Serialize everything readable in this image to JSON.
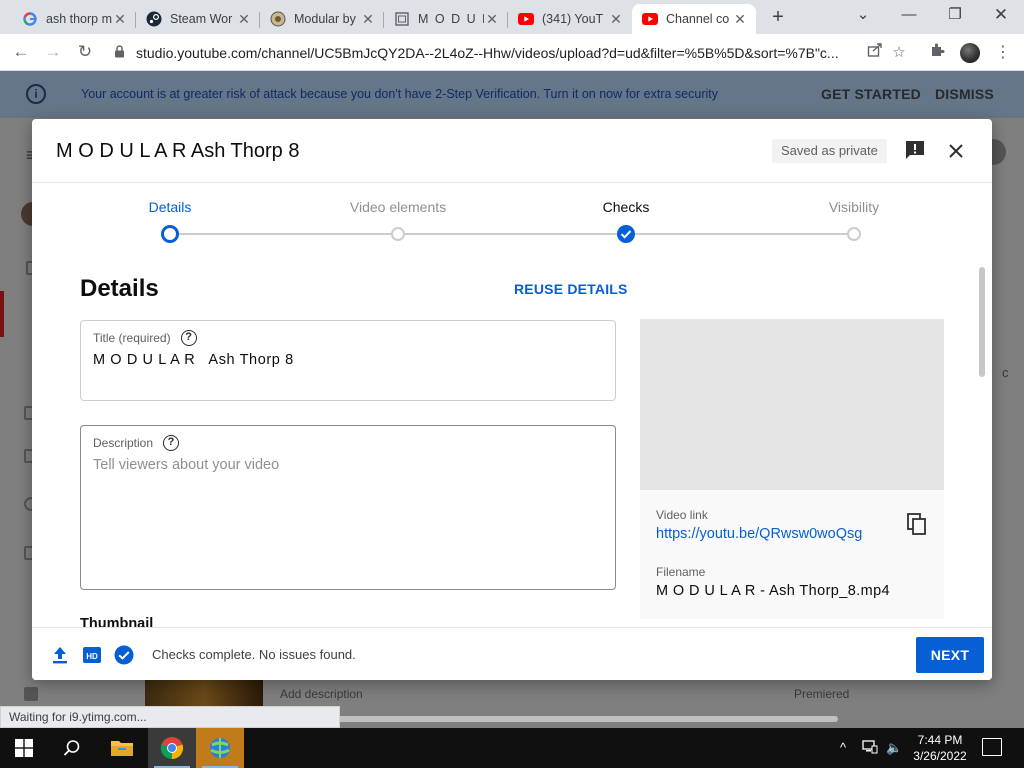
{
  "browser": {
    "tabs": [
      {
        "label": "ash thorp m",
        "icon": "google-icon"
      },
      {
        "label": "Steam Wor",
        "icon": "steam-icon"
      },
      {
        "label": "Modular by",
        "icon": "artstation-icon"
      },
      {
        "label": "M O D U L",
        "icon": "page-icon"
      },
      {
        "label": "(341) YouT",
        "icon": "youtube-icon"
      },
      {
        "label": "Channel co",
        "icon": "youtube-icon",
        "active": true
      }
    ],
    "url": "studio.youtube.com/channel/UC5BmJcQY2DA--2L4oZ--Hhw/videos/upload?d=ud&filter=%5B%5D&sort=%7B\"c...",
    "status_text": "Waiting for i9.ytimg.com..."
  },
  "warning_banner": {
    "message": "Your account is at greater risk of attack because you don't have 2-Step Verification. Turn it on now for extra security",
    "get_started": "GET STARTED",
    "dismiss": "DISMISS"
  },
  "background_page": {
    "row_description": "Add description",
    "row_status": "Premiered",
    "side_letter": "c"
  },
  "modal": {
    "title": "M O D U L A R Ash Thorp 8",
    "saved_badge": "Saved as private",
    "steps": [
      {
        "label": "Details",
        "state": "current"
      },
      {
        "label": "Video elements",
        "state": "todo"
      },
      {
        "label": "Checks",
        "state": "done"
      },
      {
        "label": "Visibility",
        "state": "todo"
      }
    ],
    "section_title": "Details",
    "reuse_details": "REUSE DETAILS",
    "title_field": {
      "label": "Title (required)",
      "value": "M O D U L A R   Ash Thorp 8"
    },
    "description_field": {
      "label": "Description",
      "placeholder": "Tell viewers about your video"
    },
    "thumbnail_heading": "Thumbnail",
    "video_link_label": "Video link",
    "video_link": "https://youtu.be/QRwsw0woQsg",
    "filename_label": "Filename",
    "filename": "M O D U L A R - Ash Thorp_8.mp4",
    "footer_status": "Checks complete. No issues found.",
    "next_button": "NEXT"
  },
  "taskbar": {
    "time": "7:44 PM",
    "date": "3/26/2022"
  },
  "colors": {
    "accent": "#065fd4",
    "banner_bg": "#657688",
    "banner_text": "#102a63"
  }
}
